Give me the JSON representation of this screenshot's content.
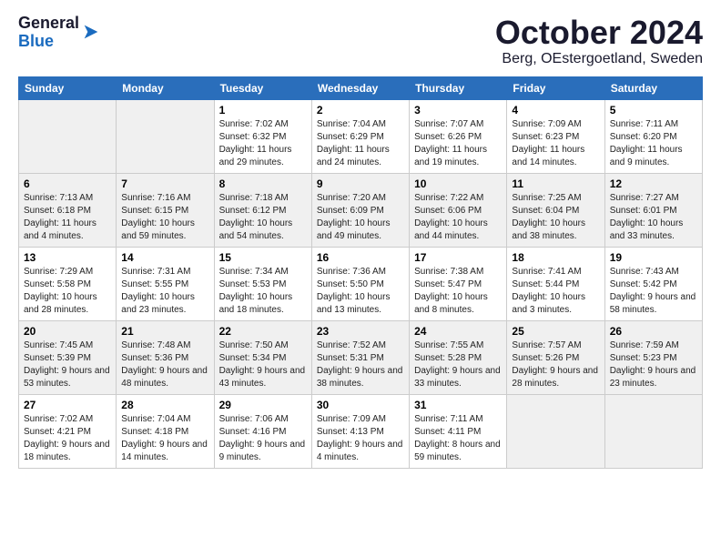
{
  "header": {
    "logo_general": "General",
    "logo_blue": "Blue",
    "month_title": "October 2024",
    "location": "Berg, OEstergoetland, Sweden"
  },
  "days_of_week": [
    "Sunday",
    "Monday",
    "Tuesday",
    "Wednesday",
    "Thursday",
    "Friday",
    "Saturday"
  ],
  "weeks": [
    [
      {
        "day": "",
        "info": ""
      },
      {
        "day": "",
        "info": ""
      },
      {
        "day": "1",
        "info": "Sunrise: 7:02 AM\nSunset: 6:32 PM\nDaylight: 11 hours and 29 minutes."
      },
      {
        "day": "2",
        "info": "Sunrise: 7:04 AM\nSunset: 6:29 PM\nDaylight: 11 hours and 24 minutes."
      },
      {
        "day": "3",
        "info": "Sunrise: 7:07 AM\nSunset: 6:26 PM\nDaylight: 11 hours and 19 minutes."
      },
      {
        "day": "4",
        "info": "Sunrise: 7:09 AM\nSunset: 6:23 PM\nDaylight: 11 hours and 14 minutes."
      },
      {
        "day": "5",
        "info": "Sunrise: 7:11 AM\nSunset: 6:20 PM\nDaylight: 11 hours and 9 minutes."
      }
    ],
    [
      {
        "day": "6",
        "info": "Sunrise: 7:13 AM\nSunset: 6:18 PM\nDaylight: 11 hours and 4 minutes."
      },
      {
        "day": "7",
        "info": "Sunrise: 7:16 AM\nSunset: 6:15 PM\nDaylight: 10 hours and 59 minutes."
      },
      {
        "day": "8",
        "info": "Sunrise: 7:18 AM\nSunset: 6:12 PM\nDaylight: 10 hours and 54 minutes."
      },
      {
        "day": "9",
        "info": "Sunrise: 7:20 AM\nSunset: 6:09 PM\nDaylight: 10 hours and 49 minutes."
      },
      {
        "day": "10",
        "info": "Sunrise: 7:22 AM\nSunset: 6:06 PM\nDaylight: 10 hours and 44 minutes."
      },
      {
        "day": "11",
        "info": "Sunrise: 7:25 AM\nSunset: 6:04 PM\nDaylight: 10 hours and 38 minutes."
      },
      {
        "day": "12",
        "info": "Sunrise: 7:27 AM\nSunset: 6:01 PM\nDaylight: 10 hours and 33 minutes."
      }
    ],
    [
      {
        "day": "13",
        "info": "Sunrise: 7:29 AM\nSunset: 5:58 PM\nDaylight: 10 hours and 28 minutes."
      },
      {
        "day": "14",
        "info": "Sunrise: 7:31 AM\nSunset: 5:55 PM\nDaylight: 10 hours and 23 minutes."
      },
      {
        "day": "15",
        "info": "Sunrise: 7:34 AM\nSunset: 5:53 PM\nDaylight: 10 hours and 18 minutes."
      },
      {
        "day": "16",
        "info": "Sunrise: 7:36 AM\nSunset: 5:50 PM\nDaylight: 10 hours and 13 minutes."
      },
      {
        "day": "17",
        "info": "Sunrise: 7:38 AM\nSunset: 5:47 PM\nDaylight: 10 hours and 8 minutes."
      },
      {
        "day": "18",
        "info": "Sunrise: 7:41 AM\nSunset: 5:44 PM\nDaylight: 10 hours and 3 minutes."
      },
      {
        "day": "19",
        "info": "Sunrise: 7:43 AM\nSunset: 5:42 PM\nDaylight: 9 hours and 58 minutes."
      }
    ],
    [
      {
        "day": "20",
        "info": "Sunrise: 7:45 AM\nSunset: 5:39 PM\nDaylight: 9 hours and 53 minutes."
      },
      {
        "day": "21",
        "info": "Sunrise: 7:48 AM\nSunset: 5:36 PM\nDaylight: 9 hours and 48 minutes."
      },
      {
        "day": "22",
        "info": "Sunrise: 7:50 AM\nSunset: 5:34 PM\nDaylight: 9 hours and 43 minutes."
      },
      {
        "day": "23",
        "info": "Sunrise: 7:52 AM\nSunset: 5:31 PM\nDaylight: 9 hours and 38 minutes."
      },
      {
        "day": "24",
        "info": "Sunrise: 7:55 AM\nSunset: 5:28 PM\nDaylight: 9 hours and 33 minutes."
      },
      {
        "day": "25",
        "info": "Sunrise: 7:57 AM\nSunset: 5:26 PM\nDaylight: 9 hours and 28 minutes."
      },
      {
        "day": "26",
        "info": "Sunrise: 7:59 AM\nSunset: 5:23 PM\nDaylight: 9 hours and 23 minutes."
      }
    ],
    [
      {
        "day": "27",
        "info": "Sunrise: 7:02 AM\nSunset: 4:21 PM\nDaylight: 9 hours and 18 minutes."
      },
      {
        "day": "28",
        "info": "Sunrise: 7:04 AM\nSunset: 4:18 PM\nDaylight: 9 hours and 14 minutes."
      },
      {
        "day": "29",
        "info": "Sunrise: 7:06 AM\nSunset: 4:16 PM\nDaylight: 9 hours and 9 minutes."
      },
      {
        "day": "30",
        "info": "Sunrise: 7:09 AM\nSunset: 4:13 PM\nDaylight: 9 hours and 4 minutes."
      },
      {
        "day": "31",
        "info": "Sunrise: 7:11 AM\nSunset: 4:11 PM\nDaylight: 8 hours and 59 minutes."
      },
      {
        "day": "",
        "info": ""
      },
      {
        "day": "",
        "info": ""
      }
    ]
  ]
}
